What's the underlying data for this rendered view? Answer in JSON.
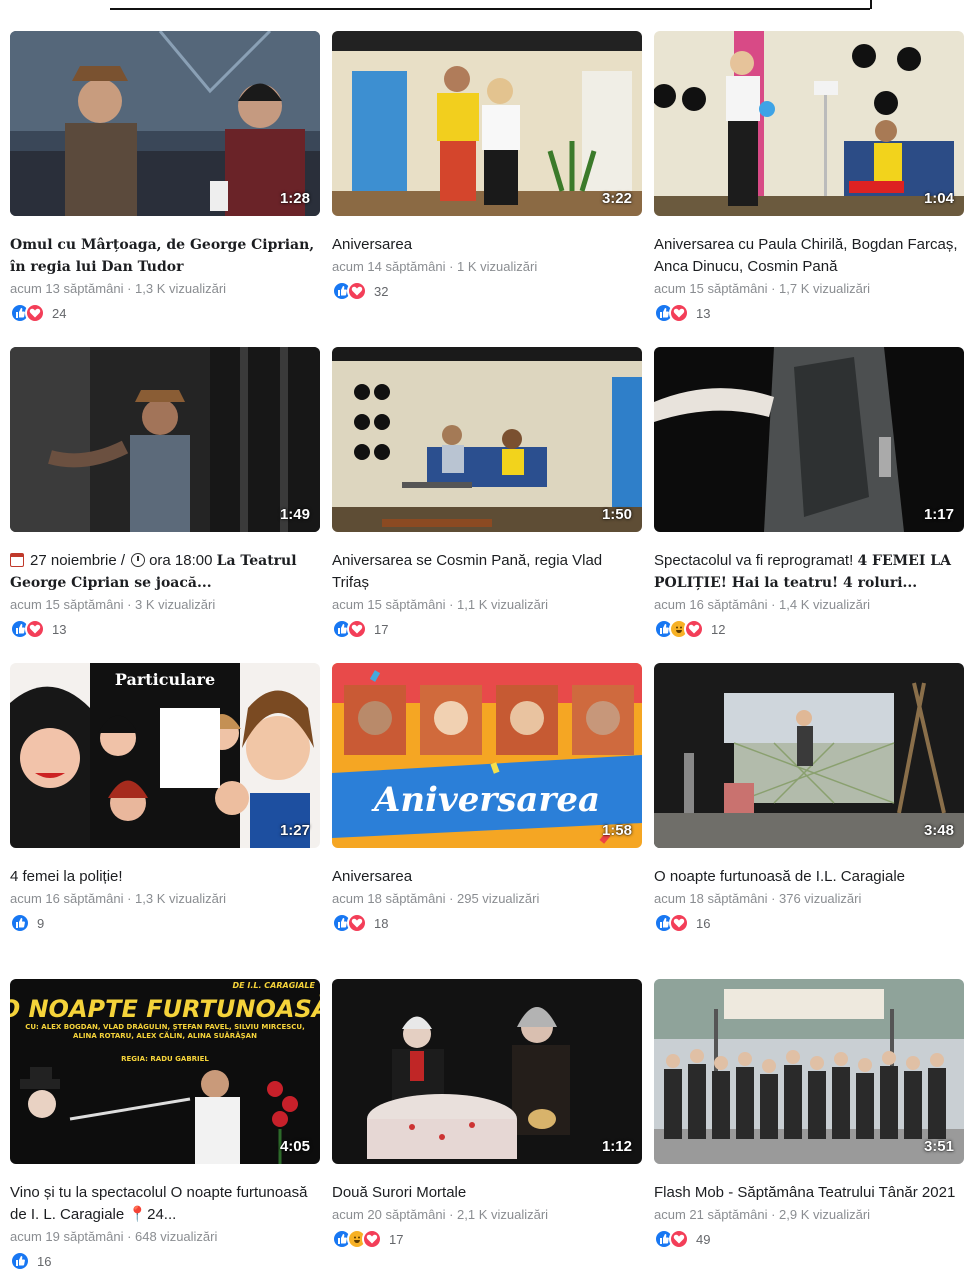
{
  "videos": [
    {
      "title": "Omul cu Mârțoaga, de George Ciprian, în regia lui Dan Tudor",
      "meta": "acum 13 săptămâni · 1,3 K vizualizări",
      "duration": "1:28",
      "reactions": [
        "like",
        "love"
      ],
      "count": "24"
    },
    {
      "title": "Aniversarea",
      "meta": "acum 14 săptămâni · 1 K vizualizări",
      "duration": "3:22",
      "reactions": [
        "like",
        "love"
      ],
      "count": "32"
    },
    {
      "title": "Aniversarea cu Paula Chirilă, Bogdan Farcaș, Anca Dinucu, Cosmin Pană",
      "meta": "acum 15 săptămâni · 1,7 K vizualizări",
      "duration": "1:04",
      "reactions": [
        "like",
        "love"
      ],
      "count": "13"
    },
    {
      "title_date": "27 noiembrie /",
      "title_time": "ora 18:00",
      "title_rest": "La Teatrul George Ciprian se joacă...",
      "meta": "acum 15 săptămâni · 3 K vizualizări",
      "duration": "1:49",
      "reactions": [
        "like",
        "love"
      ],
      "count": "13"
    },
    {
      "title": "Aniversarea se Cosmin Pană, regia Vlad Trifaș",
      "meta": "acum 15 săptămâni · 1,1 K vizualizări",
      "duration": "1:50",
      "reactions": [
        "like",
        "love"
      ],
      "count": "17"
    },
    {
      "title_lead": "Spectacolul va fi reprogramat!",
      "title_rest": "4 FEMEI LA POLIȚIE! Hai la teatru! 4 roluri...",
      "meta": "acum 16 săptămâni · 1,4 K vizualizări",
      "duration": "1:17",
      "reactions": [
        "like",
        "haha",
        "love"
      ],
      "count": "12"
    },
    {
      "title": "4 femei la poliție!",
      "meta": "acum 16 săptămâni · 1,3 K vizualizări",
      "duration": "1:27",
      "reactions": [
        "like"
      ],
      "count": "9"
    },
    {
      "title": "Aniversarea",
      "meta": "acum 18 săptămâni · 295 vizualizări",
      "duration": "1:58",
      "reactions": [
        "like",
        "love"
      ],
      "count": "18"
    },
    {
      "title": "O noapte furtunoasă de I.L. Caragiale",
      "meta": "acum 18 săptămâni · 376 vizualizări",
      "duration": "3:48",
      "reactions": [
        "like",
        "love"
      ],
      "count": "16"
    },
    {
      "title_lead": "Vino și tu la spectacolul O noapte furtunoasă de I. L. Caragiale",
      "title_rest": "24...",
      "meta": "acum 19 săptămâni · 648 vizualizări",
      "duration": "4:05",
      "reactions": [
        "like"
      ],
      "count": "16"
    },
    {
      "title": "Două Surori Mortale",
      "meta": "acum 20 săptămâni · 2,1 K vizualizări",
      "duration": "1:12",
      "reactions": [
        "like",
        "haha",
        "love"
      ],
      "count": "17"
    },
    {
      "title": "Flash Mob - Săptămâna Teatrului Tânăr 2021",
      "meta": "acum 21 săptămâni · 2,9 K vizualizări",
      "duration": "3:51",
      "reactions": [
        "like",
        "love"
      ],
      "count": "49"
    }
  ],
  "thumb_text": {
    "poster_logo": "Particulare",
    "aniversarea_banner": "Aniversarea",
    "noapte_header": "O NOAPTE FURTUNOASĂ",
    "noapte_author": "DE I.L. CARAGIALE",
    "noapte_cast": "CU: ALEX BOGDAN, VLAD DRĂGULIN, ȘTEFAN PAVEL, SILVIU MIRCESCU, ALINA ROTARU, ALEX CĂLIN, ALINA SUĂRĂȘAN",
    "noapte_director": "REGIA: RADU GABRIEL"
  },
  "colors": {
    "like": "#1877f2",
    "love": "#f33e58",
    "haha": "#f7b125",
    "meta": "#8a8d91"
  }
}
